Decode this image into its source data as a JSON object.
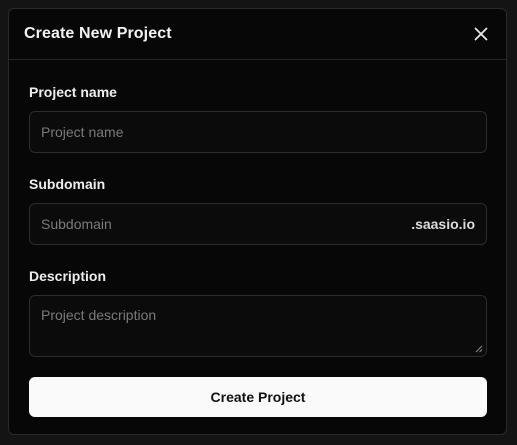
{
  "dialog": {
    "title": "Create New Project",
    "close_icon": "close-icon"
  },
  "fields": {
    "project_name": {
      "label": "Project name",
      "placeholder": "Project name",
      "value": ""
    },
    "subdomain": {
      "label": "Subdomain",
      "placeholder": "Subdomain",
      "value": "",
      "suffix": ".saasio.io"
    },
    "description": {
      "label": "Description",
      "placeholder": "Project description",
      "value": ""
    }
  },
  "actions": {
    "submit_label": "Create Project"
  },
  "colors": {
    "background": "#070707",
    "border": "#2c2c2c",
    "button_bg": "#fafafa",
    "button_text": "#111111"
  }
}
